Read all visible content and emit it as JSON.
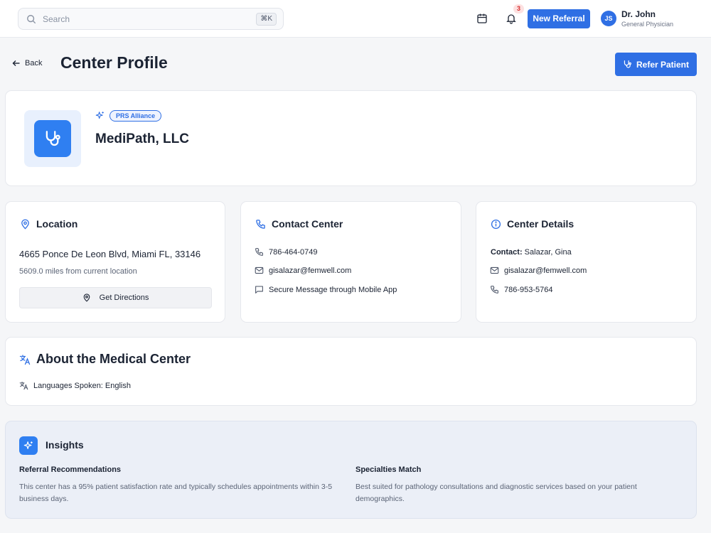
{
  "topbar": {
    "search_placeholder": "Search",
    "search_shortcut": "⌘K",
    "notification_count": "3",
    "new_referral_label": "New Referral",
    "user": {
      "initials": "JS",
      "name": "Dr. John",
      "role": "General Physician"
    }
  },
  "header": {
    "back_label": "Back",
    "title": "Center Profile",
    "refer_label": "Refer Patient"
  },
  "profile": {
    "badge": "PRS Alliance",
    "name": "MediPath, LLC"
  },
  "location": {
    "title": "Location",
    "address": "4665 Ponce De Leon Blvd, Miami FL, 33146",
    "distance": "5609.0 miles from current location",
    "directions_label": "Get Directions"
  },
  "contact": {
    "title": "Contact Center",
    "phone": "786-464-0749",
    "email": "gisalazar@femwell.com",
    "message": "Secure Message through Mobile App"
  },
  "details": {
    "title": "Center Details",
    "contact_label": "Contact:",
    "contact_name": "Salazar, Gina",
    "email": "gisalazar@femwell.com",
    "phone": "786-953-5764"
  },
  "about": {
    "title": "About the Medical Center",
    "languages": "Languages Spoken: English"
  },
  "insights": {
    "title": "Insights",
    "left_title": "Referral Recommendations",
    "left_text": "This center has a 95% patient satisfaction rate and typically schedules appointments within 3-5 business days.",
    "right_title": "Specialties Match",
    "right_text": "Best suited for pathology consultations and diagnostic services based on your patient demographics."
  },
  "colors": {
    "primary": "#2f6fe4",
    "accent_blue": "#2f7ff1",
    "badge_red": "#d62f2f"
  }
}
